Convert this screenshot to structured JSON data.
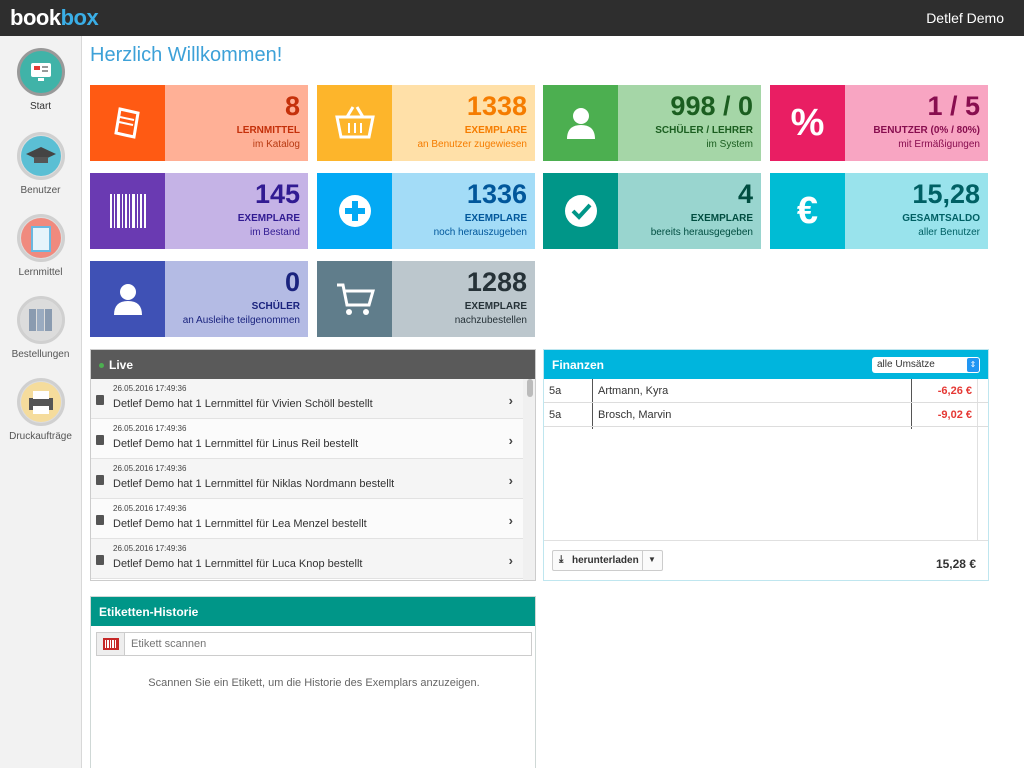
{
  "app": {
    "logo_a": "book",
    "logo_b": "box",
    "user": "Detlef Demo"
  },
  "nav": [
    {
      "label": "Start"
    },
    {
      "label": "Benutzer"
    },
    {
      "label": "Lernmittel"
    },
    {
      "label": "Bestellungen"
    },
    {
      "label": "Druckaufträge"
    }
  ],
  "welcome": "Herzlich Willkommen!",
  "tiles": [
    {
      "num": "8",
      "t1": "LERNMITTEL",
      "t2": "im Katalog",
      "icon": "book-icon"
    },
    {
      "num": "1338",
      "t1": "EXEMPLARE",
      "t2": "an Benutzer zugewiesen",
      "icon": "basket-icon"
    },
    {
      "num": "998 / 0",
      "t1": "SCHÜLER / LEHRER",
      "t2": "im System",
      "icon": "user-icon"
    },
    {
      "num": "1 / 5",
      "t1": "BENUTZER (0% / 80%)",
      "t2": "mit Ermäßigungen",
      "icon": "percent-icon"
    },
    {
      "num": "145",
      "t1": "EXEMPLARE",
      "t2": "im Bestand",
      "icon": "barcode-icon"
    },
    {
      "num": "1336",
      "t1": "EXEMPLARE",
      "t2": "noch herauszugeben",
      "icon": "plus-circle-icon"
    },
    {
      "num": "4",
      "t1": "EXEMPLARE",
      "t2": "bereits herausgegeben",
      "icon": "check-circle-icon"
    },
    {
      "num": "15,28",
      "t1": "GESAMTSALDO",
      "t2": "aller Benutzer",
      "icon": "euro-icon"
    },
    {
      "num": "0",
      "t1": "SCHÜLER",
      "t2": "an Ausleihe teilgenommen",
      "icon": "user-icon"
    },
    {
      "num": "1288",
      "t1": "EXEMPLARE",
      "t2": "nachzubestellen",
      "icon": "cart-icon"
    }
  ],
  "live": {
    "title": "Live",
    "items": [
      {
        "ts": "26.05.2016 17:49:36",
        "msg": "Detlef Demo hat 1 Lernmittel für Vivien Schöll bestellt"
      },
      {
        "ts": "26.05.2016 17:49:36",
        "msg": "Detlef Demo hat 1 Lernmittel für Linus Reil bestellt"
      },
      {
        "ts": "26.05.2016 17:49:36",
        "msg": "Detlef Demo hat 1 Lernmittel für Niklas Nordmann bestellt"
      },
      {
        "ts": "26.05.2016 17:49:36",
        "msg": "Detlef Demo hat 1 Lernmittel für Lea Menzel bestellt"
      },
      {
        "ts": "26.05.2016 17:49:36",
        "msg": "Detlef Demo hat 1 Lernmittel für Luca Knop bestellt"
      }
    ]
  },
  "finance": {
    "title": "Finanzen",
    "filter": "alle Umsätze",
    "rows": [
      {
        "cls": "5a",
        "name": "Artmann, Kyra",
        "amount": "-6,26 €"
      },
      {
        "cls": "5a",
        "name": "Brosch, Marvin",
        "amount": "-9,02 €"
      }
    ],
    "download": "herunterladen",
    "total": "15,28 €"
  },
  "labels": {
    "title": "Etiketten-Historie",
    "placeholder": "Etikett scannen",
    "hint": "Scannen Sie ein Etikett, um die Historie des Exemplars anzuzeigen."
  },
  "colors": {
    "accent": "#3aaee6",
    "live_header": "#5a5a5a",
    "finance_header": "#00b5dd",
    "labels_header": "#009688",
    "negative": "#e53935"
  }
}
